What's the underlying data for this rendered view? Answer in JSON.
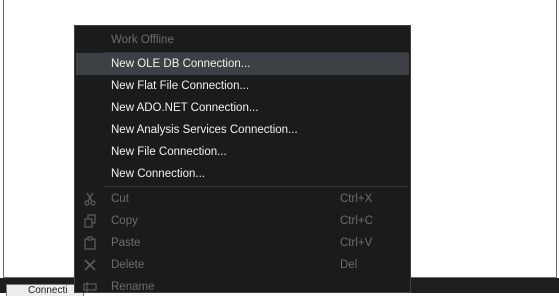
{
  "menu": {
    "work_offline": "Work Offline",
    "connections": [
      "New OLE DB Connection...",
      "New Flat File Connection...",
      "New ADO.NET Connection...",
      "New Analysis Services Connection...",
      "New File Connection...",
      "New Connection..."
    ],
    "edit": {
      "cut": {
        "label": "Cut",
        "shortcut": "Ctrl+X",
        "icon": "scissors-icon"
      },
      "copy": {
        "label": "Copy",
        "shortcut": "Ctrl+C",
        "icon": "copy-icon"
      },
      "paste": {
        "label": "Paste",
        "shortcut": "Ctrl+V",
        "icon": "paste-icon"
      },
      "delete": {
        "label": "Delete",
        "shortcut": "Del",
        "icon": "delete-x-icon"
      },
      "rename": {
        "label": "Rename",
        "icon": "rename-icon"
      }
    }
  },
  "bottom_tab": {
    "label": "Connecti"
  },
  "colors": {
    "menu_background": "#1b1b1c",
    "menu_border": "#3f3f46",
    "hover_background": "#3f3f46",
    "enabled_text": "#f1f1f1",
    "disabled_text": "#6d6d6d"
  }
}
